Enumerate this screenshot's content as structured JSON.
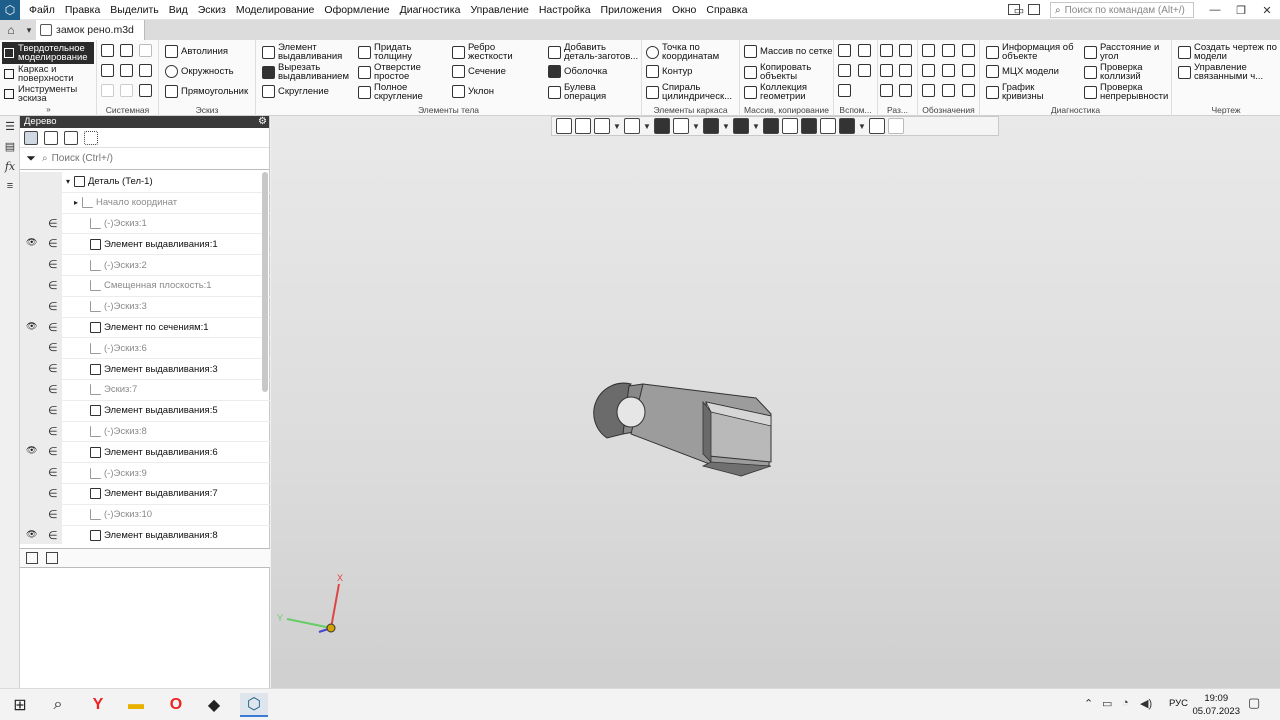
{
  "menu": {
    "items": [
      "Файл",
      "Правка",
      "Выделить",
      "Вид",
      "Эскиз",
      "Моделирование",
      "Оформление",
      "Диагностика",
      "Управление",
      "Настройка",
      "Приложения",
      "Окно",
      "Справка"
    ],
    "search_placeholder": "Поиск по командам (Alt+/)"
  },
  "tabs": {
    "doc_title": "замок рено.m3d"
  },
  "ribbon": {
    "modes": [
      "Твердотельное моделирование",
      "Каркас и поверхности",
      "Инструменты эскиза"
    ],
    "groups": {
      "system": "Системная",
      "sketch": "Эскиз",
      "body": "Элементы тела",
      "frame": "Элементы каркаса",
      "array": "Массив, копирование",
      "aux": "Вспом...",
      "dim": "Раз...",
      "notation": "Обозначения",
      "diag": "Диагностика",
      "drawing": "Чертеж"
    },
    "sketch_btns": [
      "Автолиния",
      "Окружность",
      "Прямоугольник"
    ],
    "body_btns": [
      "Элемент выдавливания",
      "Вырезать выдавливанием",
      "Скругление",
      "Придать толщину",
      "Отверстие простое",
      "Полное скругление",
      "Ребро жесткости",
      "Сечение",
      "Уклон",
      "Добавить деталь-заготов...",
      "Оболочка",
      "Булева операция"
    ],
    "frame_btns": [
      "Точка по координатам",
      "Контур",
      "Спираль цилиндрическ..."
    ],
    "array_btns": [
      "Массив по сетке",
      "Копировать объекты",
      "Коллекция геометрии"
    ],
    "diag_btns": [
      "Информация об объекте",
      "МЦХ модели",
      "График кривизны",
      "Расстояние и угол",
      "Проверка коллизий",
      "Проверка непрерывности"
    ],
    "drawing_btns": [
      "Создать чертеж по модели",
      "Управление связанными ч..."
    ]
  },
  "tree": {
    "title": "Дерево",
    "search_placeholder": "Поиск (Ctrl+/)",
    "rows": [
      {
        "label": "Деталь (Тел-1)",
        "grey": false,
        "eye": false,
        "rel": false
      },
      {
        "label": "Начало координат",
        "grey": true,
        "eye": false,
        "rel": false
      },
      {
        "label": "(-)Эскиз:1",
        "grey": true,
        "eye": false,
        "rel": true
      },
      {
        "label": "Элемент выдавливания:1",
        "grey": false,
        "eye": true,
        "rel": true
      },
      {
        "label": "(-)Эскиз:2",
        "grey": true,
        "eye": false,
        "rel": true
      },
      {
        "label": "Смещенная плоскость:1",
        "grey": true,
        "eye": false,
        "rel": true
      },
      {
        "label": "(-)Эскиз:3",
        "grey": true,
        "eye": false,
        "rel": true
      },
      {
        "label": "Элемент по сечениям:1",
        "grey": false,
        "eye": true,
        "rel": true
      },
      {
        "label": "(-)Эскиз:6",
        "grey": true,
        "eye": false,
        "rel": true
      },
      {
        "label": "Элемент выдавливания:3",
        "grey": false,
        "eye": false,
        "rel": true
      },
      {
        "label": "Эскиз:7",
        "grey": true,
        "eye": false,
        "rel": true
      },
      {
        "label": "Элемент выдавливания:5",
        "grey": false,
        "eye": false,
        "rel": true
      },
      {
        "label": "(-)Эскиз:8",
        "grey": true,
        "eye": false,
        "rel": true
      },
      {
        "label": "Элемент выдавливания:6",
        "grey": false,
        "eye": true,
        "rel": true
      },
      {
        "label": "(-)Эскиз:9",
        "grey": true,
        "eye": false,
        "rel": true
      },
      {
        "label": "Элемент выдавливания:7",
        "grey": false,
        "eye": false,
        "rel": true
      },
      {
        "label": "(-)Эскиз:10",
        "grey": true,
        "eye": false,
        "rel": true
      },
      {
        "label": "Элемент выдавливания:8",
        "grey": false,
        "eye": true,
        "rel": true
      }
    ]
  },
  "axes": {
    "x": "X",
    "y": "Y"
  },
  "taskbar": {
    "lang": "РУС",
    "time": "19:09",
    "date": "05.07.2023"
  }
}
